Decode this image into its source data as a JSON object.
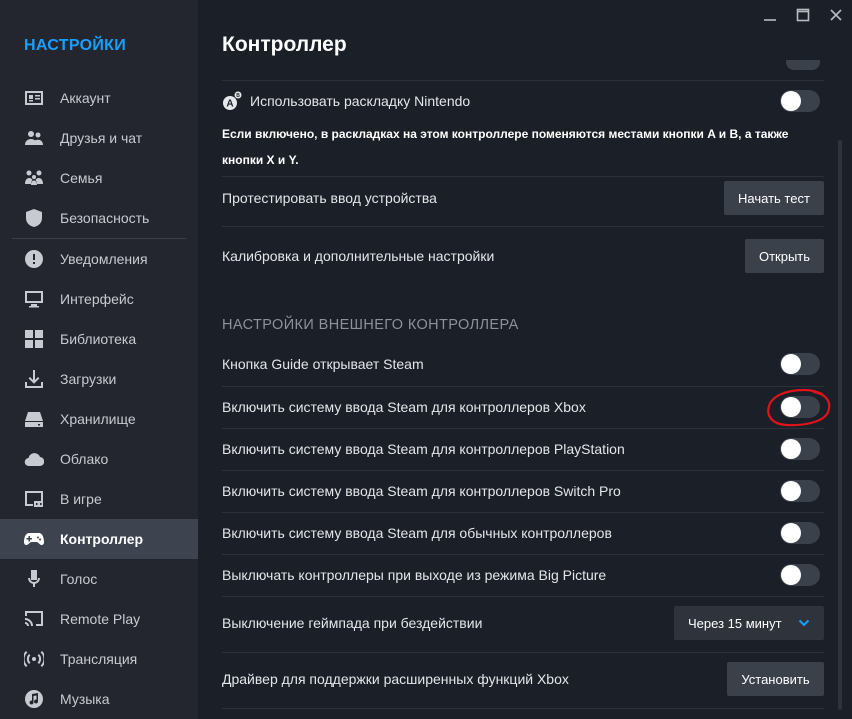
{
  "sidebar": {
    "title": "НАСТРОЙКИ",
    "items": [
      {
        "label": "Аккаунт",
        "icon": "account-card-icon"
      },
      {
        "label": "Друзья и чат",
        "icon": "friends-icon"
      },
      {
        "label": "Семья",
        "icon": "family-icon"
      },
      {
        "label": "Безопасность",
        "icon": "shield-icon"
      },
      {
        "label": "Уведомления",
        "icon": "alert-icon"
      },
      {
        "label": "Интерфейс",
        "icon": "monitor-icon"
      },
      {
        "label": "Библиотека",
        "icon": "grid-icon"
      },
      {
        "label": "Загрузки",
        "icon": "download-icon"
      },
      {
        "label": "Хранилище",
        "icon": "drive-icon"
      },
      {
        "label": "Облако",
        "icon": "cloud-icon"
      },
      {
        "label": "В игре",
        "icon": "ingame-icon"
      },
      {
        "label": "Контроллер",
        "icon": "gamepad-icon",
        "active": true
      },
      {
        "label": "Голос",
        "icon": "microphone-icon"
      },
      {
        "label": "Remote Play",
        "icon": "cast-icon"
      },
      {
        "label": "Трансляция",
        "icon": "broadcast-icon"
      },
      {
        "label": "Музыка",
        "icon": "music-icon"
      }
    ]
  },
  "main": {
    "title": "Контроллер",
    "nintendo": {
      "label": "Использовать раскладку Nintendo",
      "icon_letter": "A",
      "icon_badge": "B",
      "enabled": false,
      "description": "Если включено, в раскладках на этом контроллере поменяются местами кнопки A и B, а также кнопки X и Y."
    },
    "test_input": {
      "label": "Протестировать ввод устройства",
      "button": "Начать тест"
    },
    "calibration": {
      "label": "Калибровка и дополнительные настройки",
      "button": "Открыть"
    },
    "external_section": {
      "heading": "НАСТРОЙКИ ВНЕШНЕГО КОНТРОЛЛЕРА",
      "toggles": [
        {
          "label": "Кнопка Guide открывает Steam",
          "enabled": false
        },
        {
          "label": "Включить систему ввода Steam для контроллеров Xbox",
          "enabled": false
        },
        {
          "label": "Включить систему ввода Steam для контроллеров PlayStation",
          "enabled": false
        },
        {
          "label": "Включить систему ввода Steam для контроллеров Switch Pro",
          "enabled": false
        },
        {
          "label": "Включить систему ввода Steam для обычных контроллеров",
          "enabled": false
        },
        {
          "label": "Выключать контроллеры при выходе из режима Big Picture",
          "enabled": false
        }
      ]
    },
    "idle_shutdown": {
      "label": "Выключение геймпада при бездействии",
      "value": "Через 15 минут"
    },
    "xbox_driver": {
      "label": "Драйвер для поддержки расширенных функций Xbox",
      "button": "Установить"
    }
  },
  "colors": {
    "accent": "#1a9fff",
    "annotation": "#e0121b"
  }
}
